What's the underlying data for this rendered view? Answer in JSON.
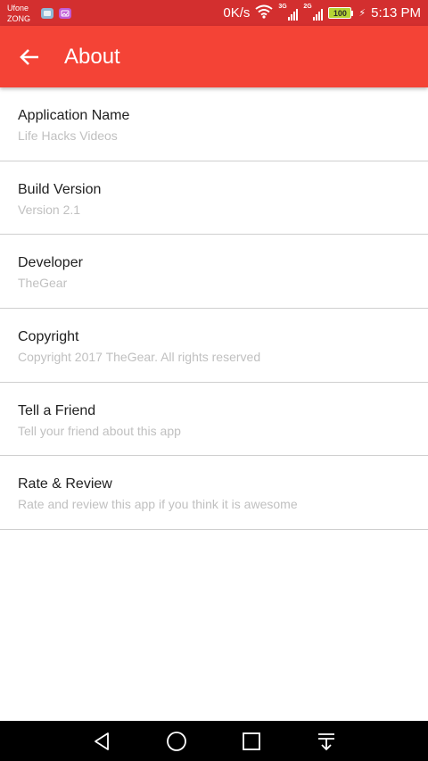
{
  "status_bar": {
    "carrier_1": "Ufone",
    "carrier_2": "ZONG",
    "network_speed": "0K/s",
    "signal_1_tag": "3G",
    "signal_2_tag": "2G",
    "battery_level": "100",
    "time": "5:13 PM"
  },
  "app_bar": {
    "title": "About",
    "background_color": "#f44336"
  },
  "items": [
    {
      "title": "Application Name",
      "subtitle": "Life Hacks Videos"
    },
    {
      "title": "Build Version",
      "subtitle": "Version 2.1"
    },
    {
      "title": "Developer",
      "subtitle": "TheGear"
    },
    {
      "title": "Copyright",
      "subtitle": "Copyright 2017 TheGear. All rights reserved"
    },
    {
      "title": "Tell a Friend",
      "subtitle": "Tell your friend about this app"
    },
    {
      "title": "Rate & Review",
      "subtitle": "Rate and review this app if you think it is awesome"
    }
  ],
  "icons": {
    "back": "arrow-left-icon",
    "nav_back": "triangle-back-icon",
    "nav_home": "circle-home-icon",
    "nav_recents": "square-recents-icon",
    "nav_notifications": "pull-down-icon"
  }
}
